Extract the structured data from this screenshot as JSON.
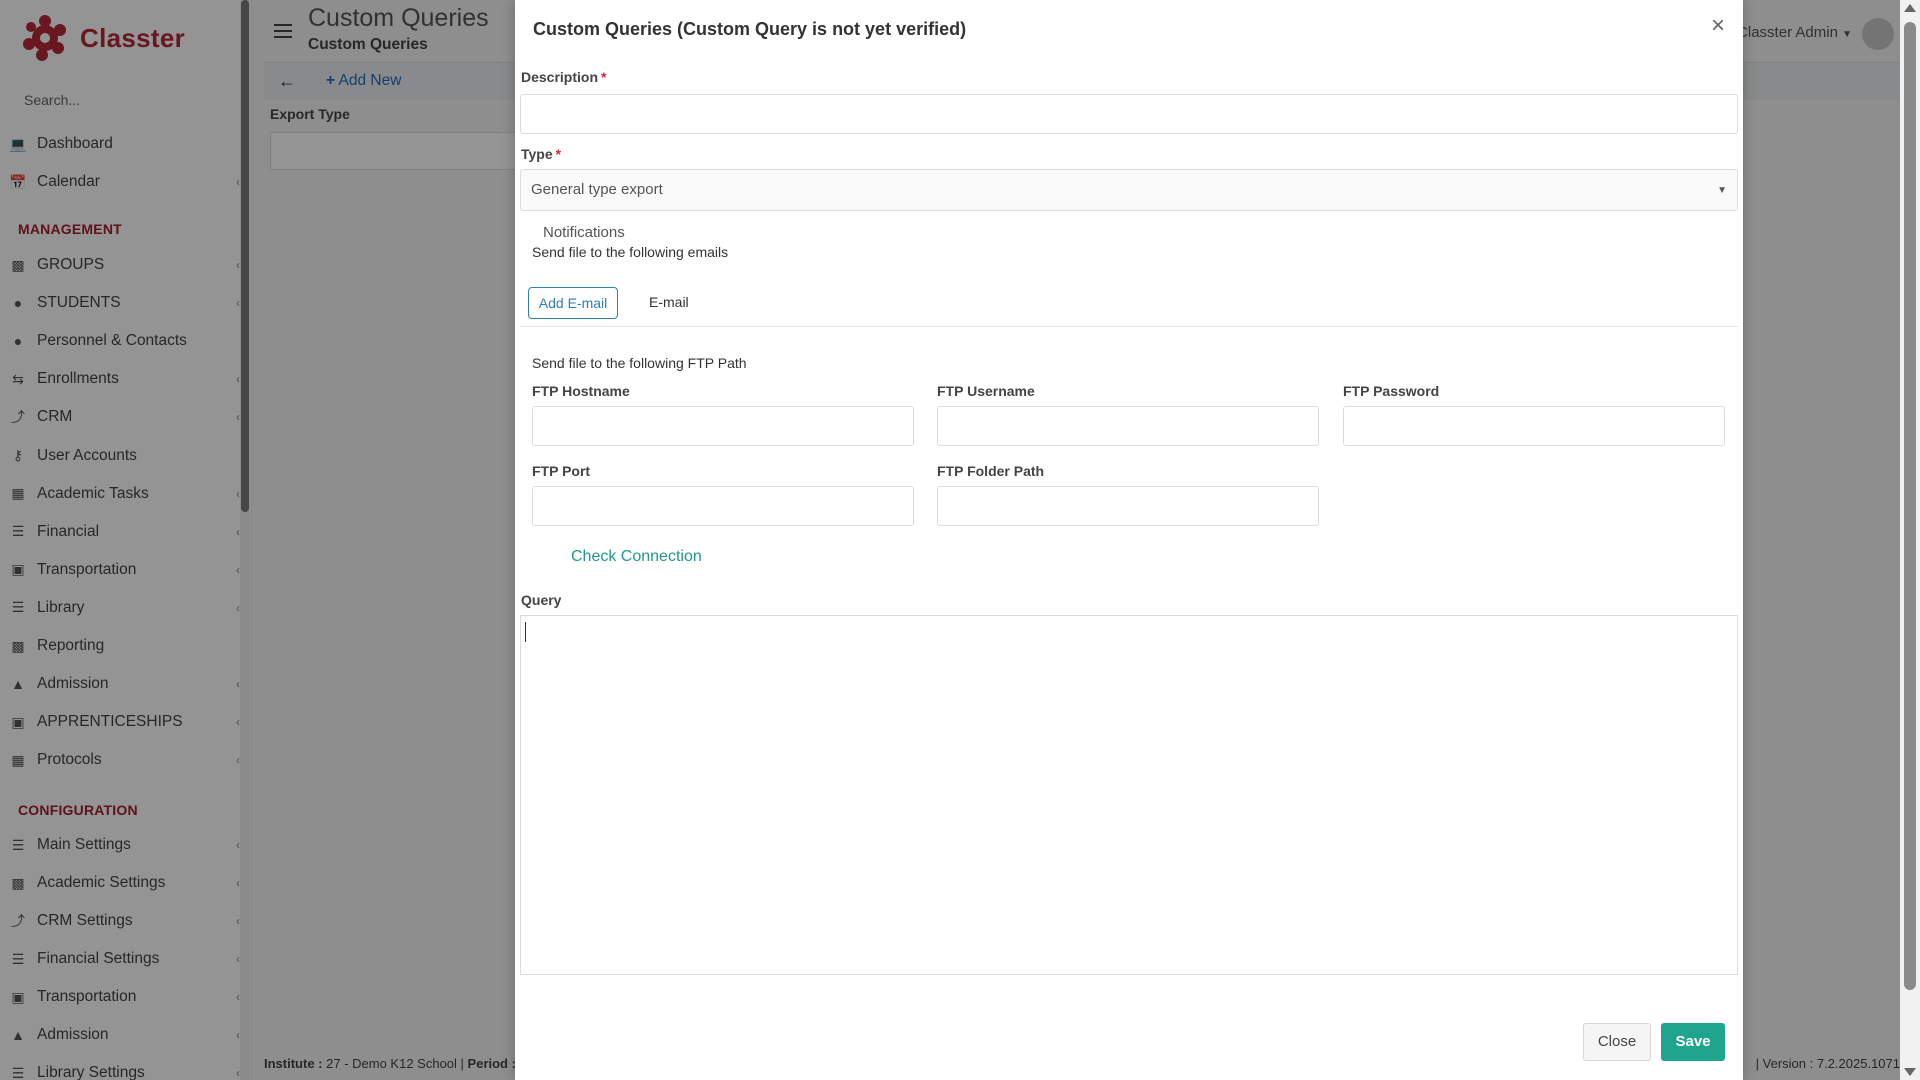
{
  "brand": {
    "name": "Classter",
    "color": "#b5283a"
  },
  "sidebar": {
    "search_placeholder": "Search...",
    "items_top": [
      {
        "label": "Dashboard",
        "icon": "laptop-icon",
        "chevron": false
      },
      {
        "label": "Calendar",
        "icon": "calendar-icon",
        "chevron": true
      }
    ],
    "section_management": "MANAGEMENT",
    "items_management": [
      {
        "label": "GROUPS",
        "icon": "groups-icon",
        "chevron": true
      },
      {
        "label": "STUDENTS",
        "icon": "students-icon",
        "chevron": true
      },
      {
        "label": "Personnel & Contacts",
        "icon": "person-icon",
        "chevron": false
      },
      {
        "label": "Enrollments",
        "icon": "exchange-icon",
        "chevron": true
      },
      {
        "label": "CRM",
        "icon": "crm-icon",
        "chevron": true
      },
      {
        "label": "User Accounts",
        "icon": "key-icon",
        "chevron": false
      },
      {
        "label": "Academic Tasks",
        "icon": "grid-icon",
        "chevron": true
      },
      {
        "label": "Financial",
        "icon": "coins-icon",
        "chevron": true
      },
      {
        "label": "Transportation",
        "icon": "bus-icon",
        "chevron": true
      },
      {
        "label": "Library",
        "icon": "library-icon",
        "chevron": true
      },
      {
        "label": "Reporting",
        "icon": "print-icon",
        "chevron": false
      },
      {
        "label": "Admission",
        "icon": "institution-icon",
        "chevron": true
      },
      {
        "label": "APPRENTICESHIPS",
        "icon": "box-icon",
        "chevron": true
      },
      {
        "label": "Protocols",
        "icon": "protocol-icon",
        "chevron": true
      }
    ],
    "section_configuration": "CONFIGURATION",
    "items_configuration": [
      {
        "label": "Main Settings",
        "icon": "sliders-icon",
        "chevron": true
      },
      {
        "label": "Academic Settings",
        "icon": "groups-icon",
        "chevron": true
      },
      {
        "label": "CRM Settings",
        "icon": "crm-icon",
        "chevron": true
      },
      {
        "label": "Financial Settings",
        "icon": "coins-icon",
        "chevron": true
      },
      {
        "label": "Transportation",
        "icon": "bus-icon",
        "chevron": true
      },
      {
        "label": "Admission",
        "icon": "institution-icon",
        "chevron": true
      },
      {
        "label": "Library Settings",
        "icon": "library-icon",
        "chevron": true
      }
    ]
  },
  "header": {
    "title": "Custom Queries",
    "subtitle": "Custom Queries",
    "add_new": "Add New",
    "export_type_label": "Export Type",
    "user_name": "Classter Admin"
  },
  "footer": {
    "institute_label": "Institute :",
    "institute_value": "27 - Demo K12 School",
    "period_label": "Period :",
    "version": "| Version : 7.2.2025.1071"
  },
  "modal": {
    "title": "Custom Queries (Custom Query is not yet verified)",
    "description_label": "Description",
    "description_value": "",
    "type_label": "Type",
    "type_value": "General type export",
    "notifications_title": "Notifications",
    "send_emails_text": "Send file to the following emails",
    "add_email_label": "Add E-mail",
    "email_column": "E-mail",
    "send_ftp_text": "Send file to the following FTP Path",
    "ftp_hostname_label": "FTP Hostname",
    "ftp_username_label": "FTP Username",
    "ftp_password_label": "FTP Password",
    "ftp_port_label": "FTP Port",
    "ftp_folder_label": "FTP Folder Path",
    "check_connection": "Check Connection",
    "query_label": "Query",
    "query_value": "",
    "close_label": "Close",
    "save_label": "Save"
  },
  "colors": {
    "save": "#1fa58e",
    "link": "#1f9a8a",
    "required": "#d9263a",
    "add_new": "#2a6cc1"
  }
}
